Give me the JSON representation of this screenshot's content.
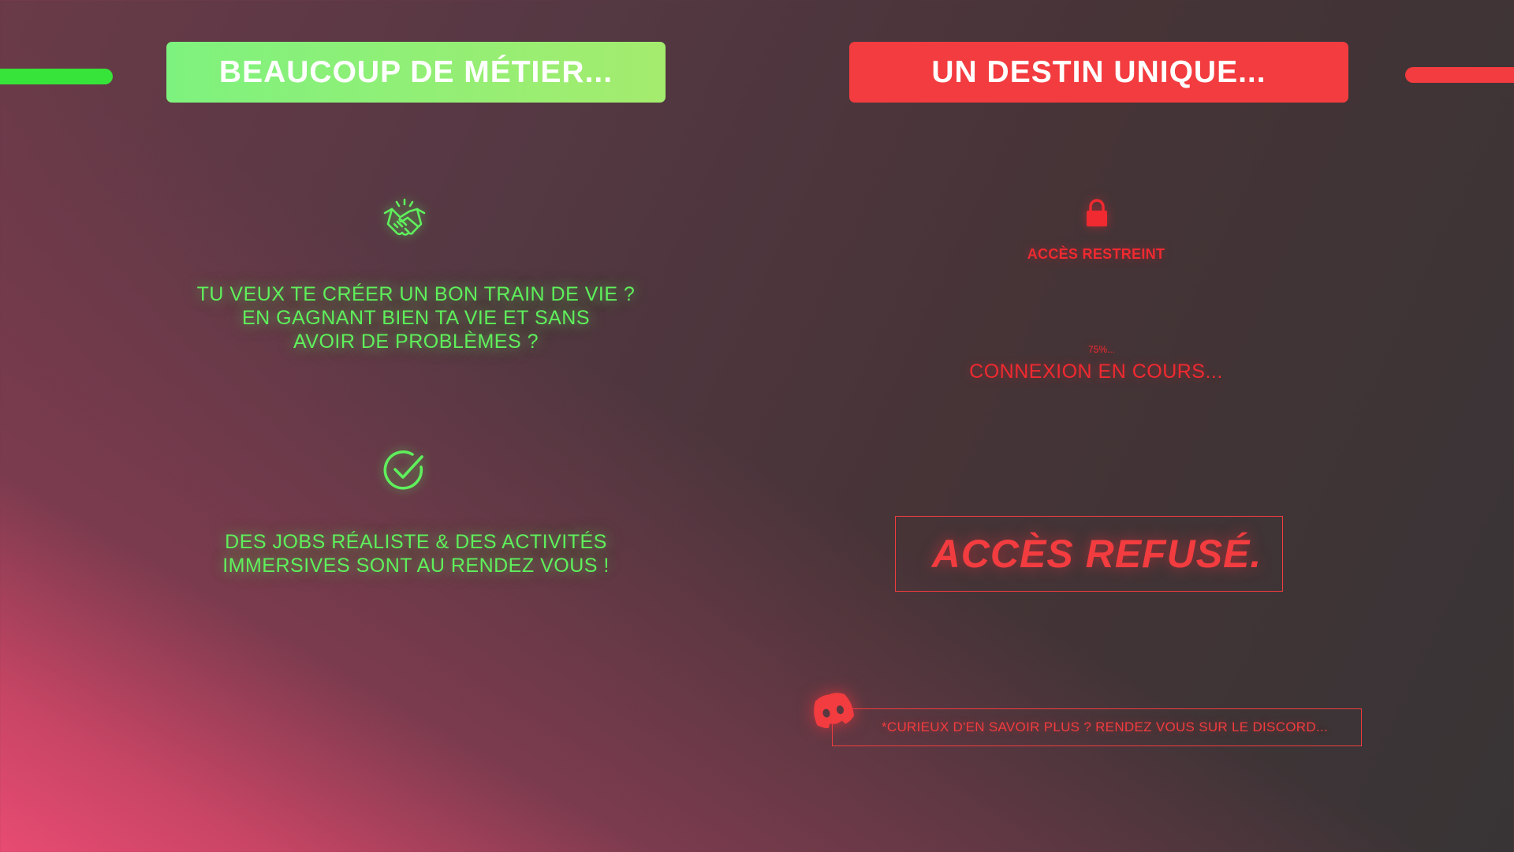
{
  "left_panel": {
    "banner_title": "BEAUCOUP DE MÉTIER...",
    "icon_top": "handshake-icon",
    "text_1": "TU VEUX TE CRÉER UN BON TRAIN DE VIE ?\nEN GAGNANT BIEN TA VIE ET SANS\nAVOIR DE PROBLÈMES ?",
    "icon_bottom": "check-circle-icon",
    "text_2": "DES JOBS RÉALISTE & DES ACTIVITÉS\nIMMERSIVES SONT AU RENDEZ VOUS !"
  },
  "right_panel": {
    "banner_title": "UN DESTIN UNIQUE...",
    "icon_lock": "lock-icon",
    "access_label": "ACCÈS RESTREINT",
    "progress_text": "75%...",
    "progress_value": 0.75,
    "connecting_label": "CONNEXION EN COURS...",
    "denied_label": "ACCÈS REFUSÉ.",
    "icon_discord": "discord-icon",
    "discord_hint": "*CURIEUX D'EN SAVOIR PLUS ? RENDEZ VOUS SUR LE DISCORD..."
  },
  "colors": {
    "accent_green": "#5ff05c",
    "accent_red": "#f23c3f",
    "banner_green_start": "#7ef27e",
    "banner_green_end": "#a4ec6e",
    "background_dark": "#383435",
    "background_pink": "#e84b72"
  }
}
